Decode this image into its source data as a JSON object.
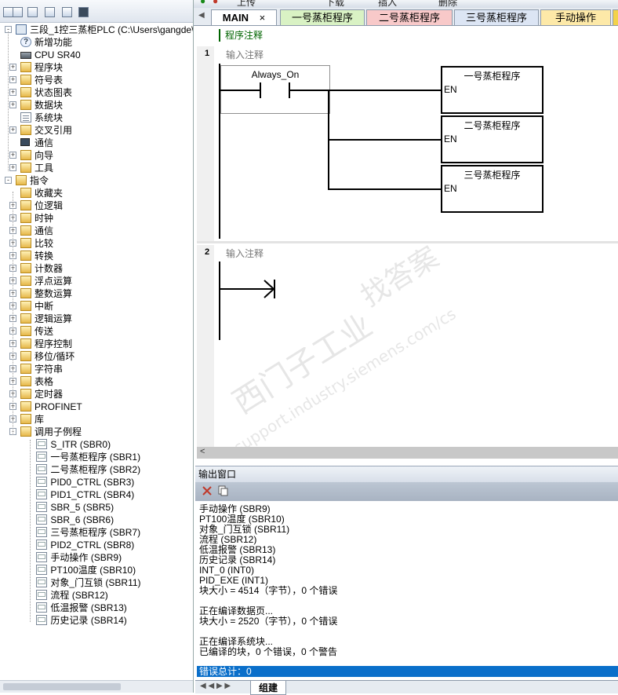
{
  "project_tree": {
    "root": "三段_1控三蒸柜PLC (C:\\Users\\gangde\\Des",
    "items": [
      {
        "label": "新增功能",
        "icon": "help-icon"
      },
      {
        "label": "CPU SR40",
        "icon": "cpu-icon"
      },
      {
        "label": "程序块",
        "icon": "folder-icon"
      },
      {
        "label": "符号表",
        "icon": "folder-icon"
      },
      {
        "label": "状态图表",
        "icon": "folder-icon"
      },
      {
        "label": "数据块",
        "icon": "folder-icon"
      },
      {
        "label": "系统块",
        "icon": "doc-icon"
      },
      {
        "label": "交叉引用",
        "icon": "folder-icon"
      },
      {
        "label": "通信",
        "icon": "comm-icon"
      },
      {
        "label": "向导",
        "icon": "folder-icon"
      },
      {
        "label": "工具",
        "icon": "folder-icon"
      }
    ]
  },
  "instructions": {
    "root": "指令",
    "items": [
      "收藏夹",
      "位逻辑",
      "时钟",
      "通信",
      "比较",
      "转换",
      "计数器",
      "浮点运算",
      "整数运算",
      "中断",
      "逻辑运算",
      "传送",
      "程序控制",
      "移位/循环",
      "字符串",
      "表格",
      "定时器",
      "PROFINET",
      "库",
      "调用子例程"
    ]
  },
  "subroutines": [
    "S_ITR (SBR0)",
    "一号蒸柜程序 (SBR1)",
    "二号蒸柜程序 (SBR2)",
    "PID0_CTRL (SBR3)",
    "PID1_CTRL (SBR4)",
    "SBR_5 (SBR5)",
    "SBR_6 (SBR6)",
    "三号蒸柜程序 (SBR7)",
    "PID2_CTRL (SBR8)",
    "手动操作 (SBR9)",
    "PT100温度 (SBR10)",
    "对象_门互锁 (SBR11)",
    "流程 (SBR12)",
    "低温报警 (SBR13)",
    "历史记录 (SBR14)"
  ],
  "toolbar": {
    "upload": "上传",
    "download": "下载",
    "insert": "插入",
    "delete": "删除"
  },
  "tabs": [
    {
      "label": "MAIN",
      "close": "×",
      "color": "#ffffff"
    },
    {
      "label": "一号蒸柜程序",
      "color": "#d9f2c4"
    },
    {
      "label": "二号蒸柜程序",
      "color": "#f8c9c9"
    },
    {
      "label": "三号蒸柜程序",
      "color": "#dce5f4"
    },
    {
      "label": "手动操作",
      "color": "#fde9a8"
    }
  ],
  "editor": {
    "program_comment": "程序注释",
    "networks": [
      {
        "number": "1",
        "comment": "输入注释",
        "contact": "Always_On",
        "boxes": [
          "一号蒸柜程序",
          "二号蒸柜程序",
          "三号蒸柜程序"
        ],
        "en": "EN"
      },
      {
        "number": "2",
        "comment": "输入注释"
      }
    ]
  },
  "output": {
    "title": "输出窗口",
    "lines": [
      "手动操作 (SBR9)",
      "PT100温度 (SBR10)",
      "对象_门互锁 (SBR11)",
      "流程 (SBR12)",
      "低温报警 (SBR13)",
      "历史记录 (SBR14)",
      "INT_0 (INT0)",
      "PID_EXE (INT1)",
      "块大小 = 4514（字节），0 个错误",
      "",
      "正在编译数据页...",
      "块大小 = 2520（字节），0 个错误",
      "",
      "正在编译系统块...",
      "已编译的块，0 个错误，0 个警告"
    ],
    "error_total": "错误总计：0",
    "bottom_tab": "组建"
  },
  "watermark": {
    "line1": "西门子工业",
    "line2": "找答案",
    "line3": "support.industry.siemens.com/cs"
  }
}
